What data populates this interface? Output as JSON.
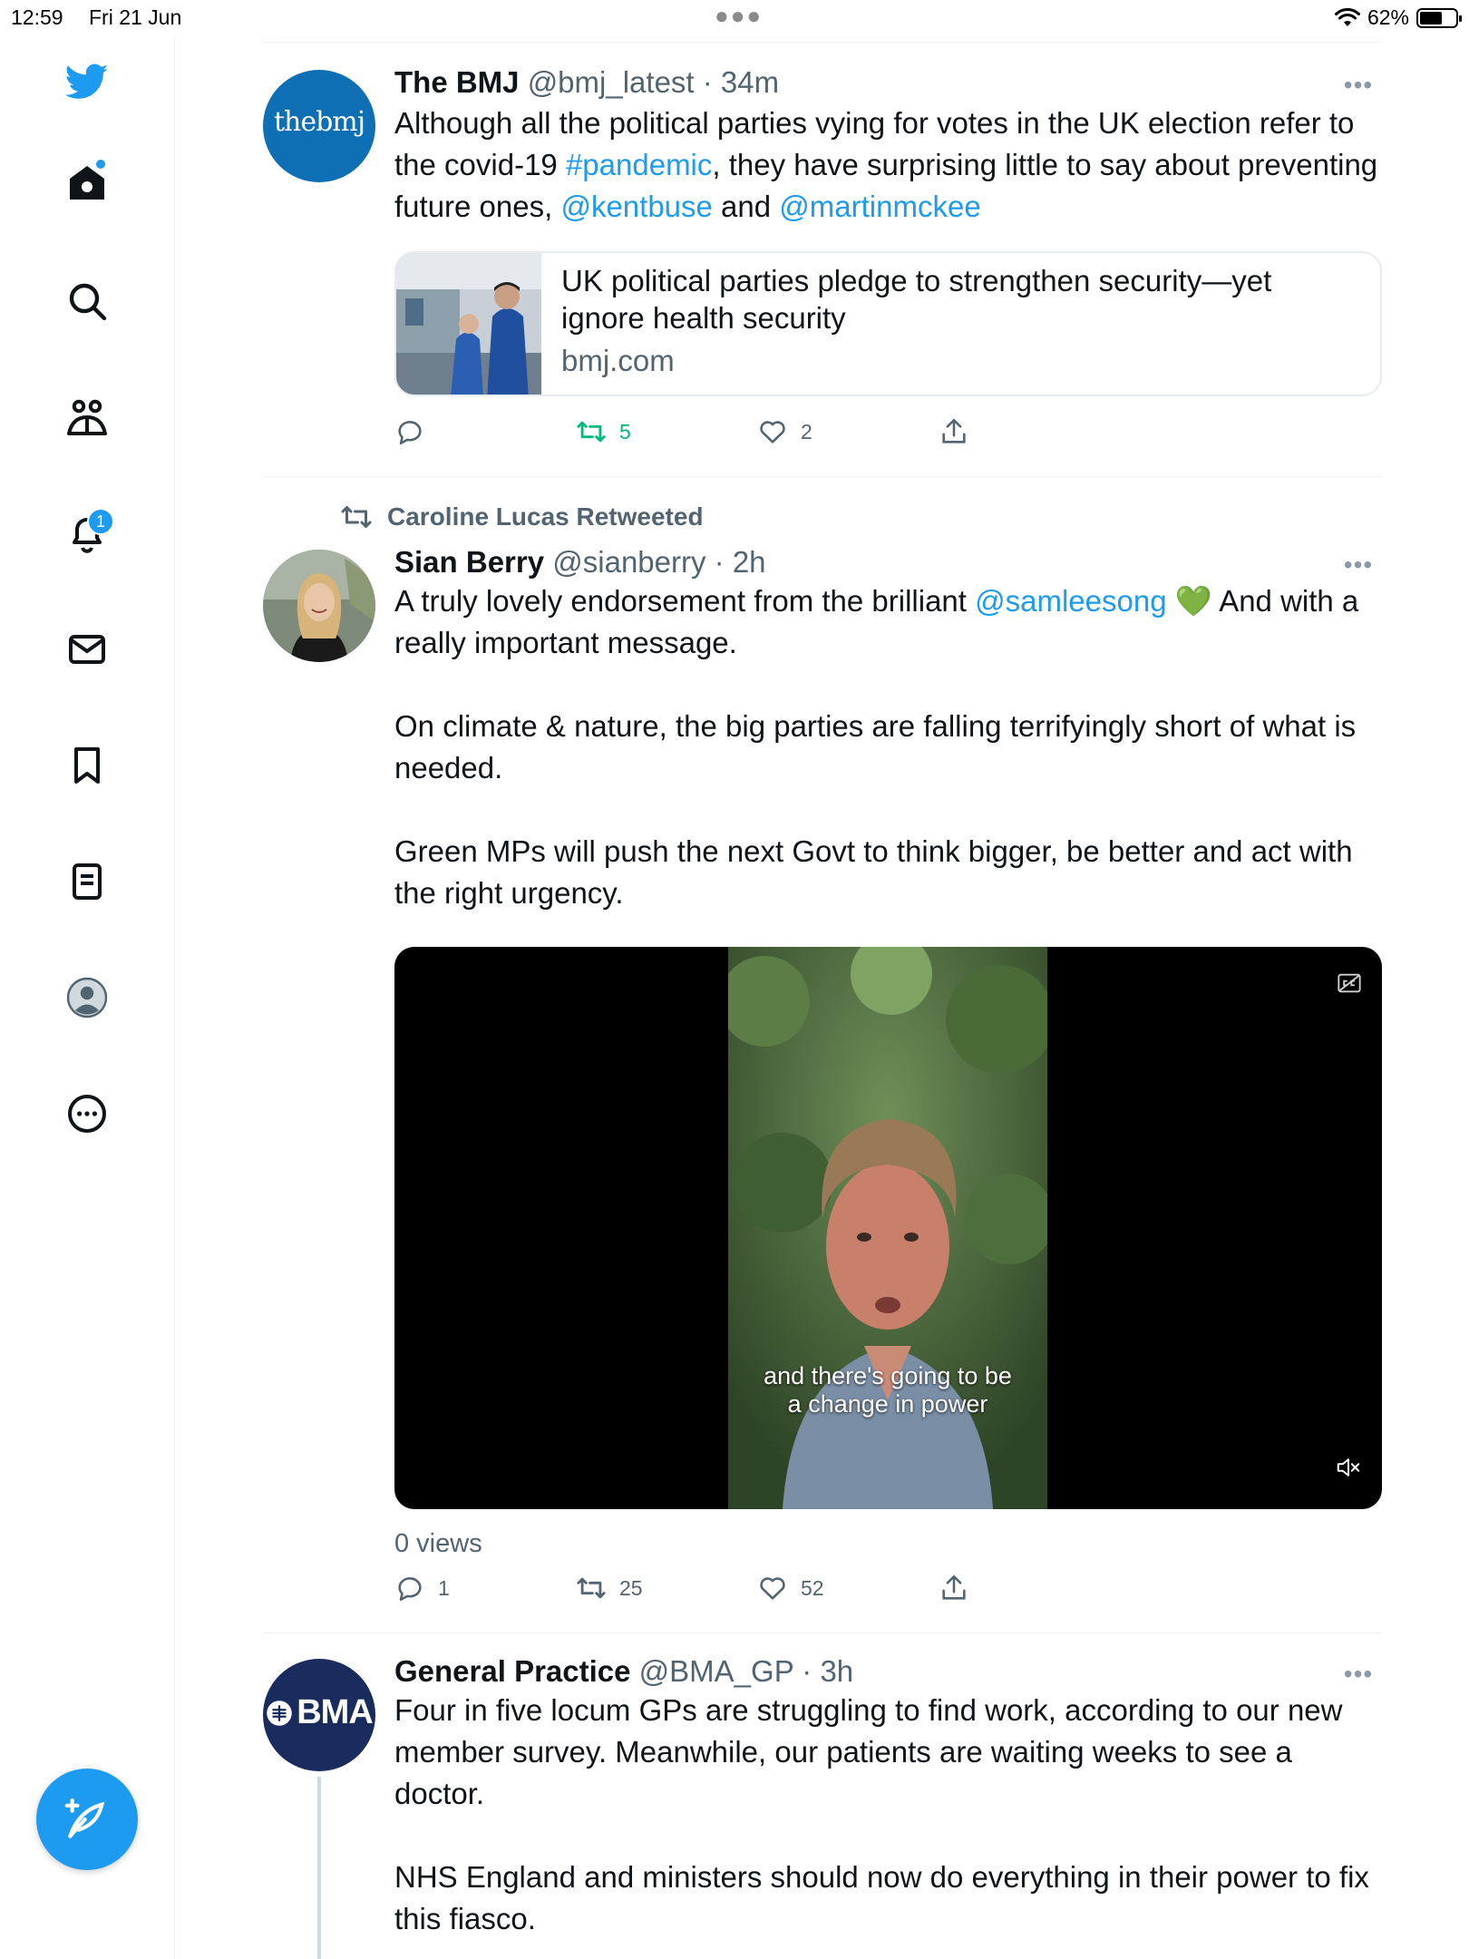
{
  "status_bar": {
    "time": "12:59",
    "date": "Fri 21 Jun",
    "battery": "62%",
    "battery_level": 0.62
  },
  "sidebar": {
    "items": [
      {
        "icon": "twitter-logo-icon"
      },
      {
        "icon": "home-icon"
      },
      {
        "icon": "search-icon"
      },
      {
        "icon": "communities-icon"
      },
      {
        "icon": "notifications-icon",
        "badge": "1"
      },
      {
        "icon": "messages-icon"
      },
      {
        "icon": "bookmarks-icon"
      },
      {
        "icon": "lists-icon"
      },
      {
        "icon": "profile-icon"
      },
      {
        "icon": "more-icon"
      }
    ],
    "compose_icon": "compose-icon"
  },
  "colors": {
    "accent": "#1d9bf0",
    "retweet_active": "#00ba7c",
    "muted": "#536471"
  },
  "tweets": [
    {
      "avatar_text": "thebmj",
      "name": "The BMJ",
      "meta": "@bmj_latest · 34m",
      "text": {
        "p1_a": "Although all the political parties vying for votes in the UK election refer to the covid-19 ",
        "hashtag": "#pandemic",
        "p1_b": ", they have surprising little to say about preventing future ones, ",
        "mention1": "@kentbuse",
        "p1_c": " and ",
        "mention2": "@martinmckee"
      },
      "card": {
        "title": "UK political parties pledge to strengthen security—yet ignore health security",
        "domain": "bmj.com"
      },
      "replies": "",
      "retweets": "5",
      "likes": "2"
    },
    {
      "retweeted_by": "Caroline Lucas Retweeted",
      "name": "Sian Berry",
      "meta": "@sianberry · 2h",
      "text": {
        "p1_a": "A truly lovely endorsement from the brilliant ",
        "mention": "@samleesong",
        "emoji": "💚",
        "p1_b": " And with a really important message.",
        "p2": "On climate & nature, the big parties are falling terrifyingly short of what is needed.",
        "p3": "Green MPs will push the next Govt to think bigger, be better and act with the right urgency."
      },
      "video": {
        "subtitle_line1": "and there's going to be",
        "subtitle_line2": "a change in power"
      },
      "views": "0 views",
      "replies": "1",
      "retweets": "25",
      "likes": "52"
    },
    {
      "avatar_text": "BMA",
      "name": "General Practice",
      "meta": "@BMA_GP · 3h",
      "text": {
        "p1": "Four in five locum GPs are struggling to find work, according to our new member survey. Meanwhile, our patients are waiting weeks to see a doctor.",
        "p2": "NHS England and ministers should now do everything in their power to fix this fiasco."
      }
    }
  ]
}
